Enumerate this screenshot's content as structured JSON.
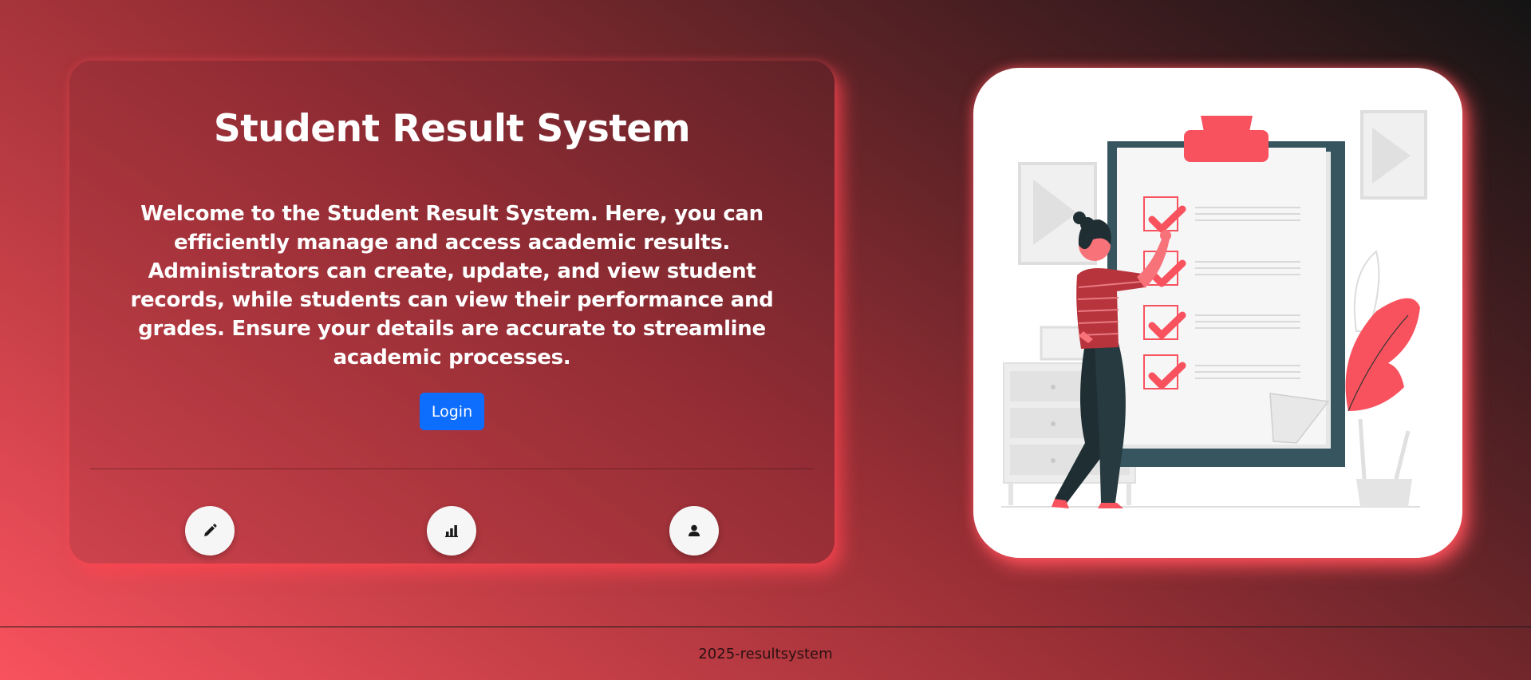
{
  "hero": {
    "title": "Student Result System",
    "description": "Welcome to the Student Result System. Here, you can efficiently manage and access academic results. Administrators can create, update, and view student records, while students can view their performance and grades. Ensure your details are accurate to streamline academic processes.",
    "login_label": "Login"
  },
  "features": [
    {
      "icon": "pencil-icon"
    },
    {
      "icon": "bar-chart-icon"
    },
    {
      "icon": "user-icon"
    }
  ],
  "illustration": {
    "icon": "clipboard-checklist-illustration",
    "accent_color": "#f8525e",
    "board_color": "#37555e"
  },
  "footer": {
    "text": "2025-resultsystem"
  },
  "colors": {
    "primary_button": "#0d6efd",
    "gradient_light": "#f8525e",
    "gradient_dark": "#141414"
  }
}
